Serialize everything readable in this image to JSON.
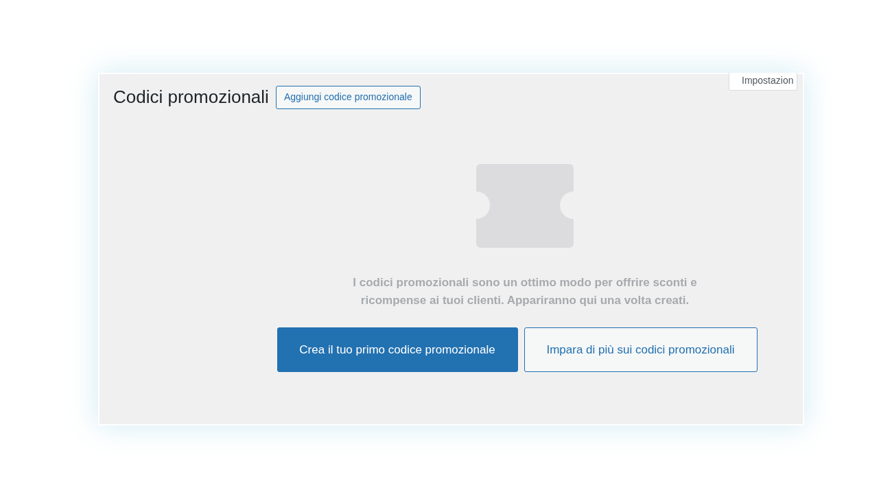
{
  "header": {
    "title": "Codici promozionali",
    "add_button": "Aggiungi codice promozionale",
    "settings_tab": "Impostazion"
  },
  "empty_state": {
    "message": "I codici promozionali sono un ottimo modo per offrire sconti e ricompense ai tuoi clienti. Appariranno qui una volta creati.",
    "buttons": [
      {
        "kind": "primary",
        "label": "Crea il tuo primo codice promozionale"
      },
      {
        "kind": "secondary",
        "label": "Impara di più sui codici promozionali"
      }
    ]
  }
}
